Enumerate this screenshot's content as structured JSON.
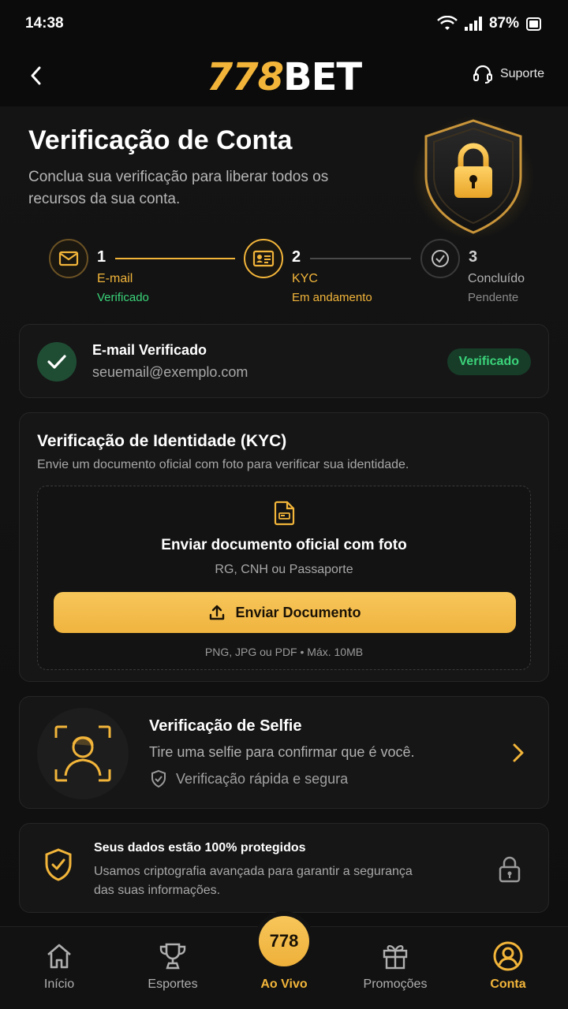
{
  "status_bar": {
    "time": "14:38",
    "battery": "87%"
  },
  "header": {
    "logo_number": "778",
    "logo_text": "BET",
    "support_label": "Suporte"
  },
  "hero": {
    "title": "Verificação de Conta",
    "subtitle": "Conclua sua verificação para liberar todos os recursos da sua conta."
  },
  "steps": [
    {
      "number": "1",
      "label": "E-mail",
      "status": "Verificado",
      "state": "done"
    },
    {
      "number": "2",
      "label": "KYC",
      "status": "Em andamento",
      "state": "active"
    },
    {
      "number": "3",
      "label": "Concluído",
      "status": "Pendente",
      "state": "pending"
    }
  ],
  "email_card": {
    "title": "E-mail Verificado",
    "email": "seuemail@exemplo.com",
    "badge": "Verificado"
  },
  "kyc_card": {
    "title": "Verificação de Identidade (KYC)",
    "description": "Envie um documento oficial com foto para verificar sua identidade.",
    "drop_title": "Enviar documento oficial com foto",
    "drop_subtitle": "RG, CNH ou Passaporte",
    "button_label": "Enviar Documento",
    "note": "PNG, JPG ou PDF • Máx. 10MB"
  },
  "selfie_card": {
    "title": "Verificação de Selfie",
    "description": "Tire uma selfie para confirmar que é você.",
    "badge": "Verificação rápida e segura"
  },
  "protect_card": {
    "title": "Seus dados estão 100% protegidos",
    "description": "Usamos criptografia avançada para garantir a segurança das suas informações."
  },
  "bottom_nav": {
    "items": [
      {
        "label": "Início",
        "icon": "home-icon"
      },
      {
        "label": "Esportes",
        "icon": "trophy-icon"
      },
      {
        "label": "Ao Vivo",
        "icon": "778-badge"
      },
      {
        "label": "Promoções",
        "icon": "gift-icon"
      },
      {
        "label": "Conta",
        "icon": "user-circle-icon"
      }
    ],
    "live_badge": "778",
    "active_index": 4
  },
  "colors": {
    "accent": "#f2b53a",
    "success": "#3bd47a",
    "background": "#0b0b0b"
  }
}
